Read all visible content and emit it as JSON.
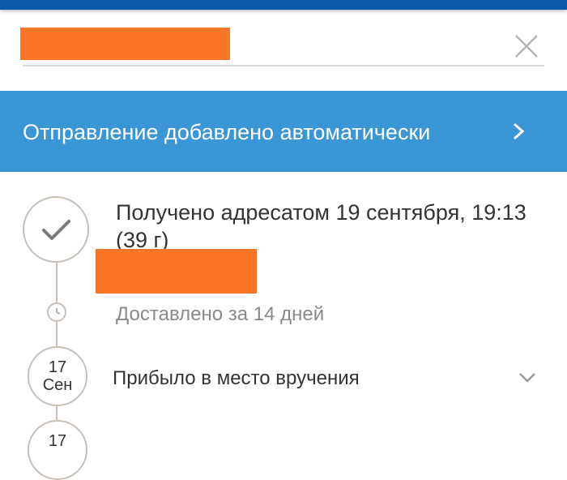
{
  "search": {
    "redacted_value": "",
    "close_icon": "close-icon"
  },
  "banner": {
    "text": "Отправление добавлено автоматически",
    "icon": "chevron-right-icon"
  },
  "timeline": {
    "latest": {
      "status": "Получено адресатом 19 сентября, 19:13",
      "weight": "(39 г)",
      "icon": "check-icon",
      "redacted_address": ""
    },
    "delivery_time": {
      "icon": "clock-icon",
      "text": "Доставлено за 14 дней"
    },
    "events": [
      {
        "day": "17",
        "month": "Сен",
        "status": "Прибыло в место вручения",
        "icon": "chevron-down-icon"
      },
      {
        "day": "17",
        "month": "",
        "status": ""
      }
    ]
  },
  "colors": {
    "top_bar": "#0b59a6",
    "banner": "#3b96d6",
    "redaction": "#fa7626",
    "timeline": "#c8c0b6"
  }
}
